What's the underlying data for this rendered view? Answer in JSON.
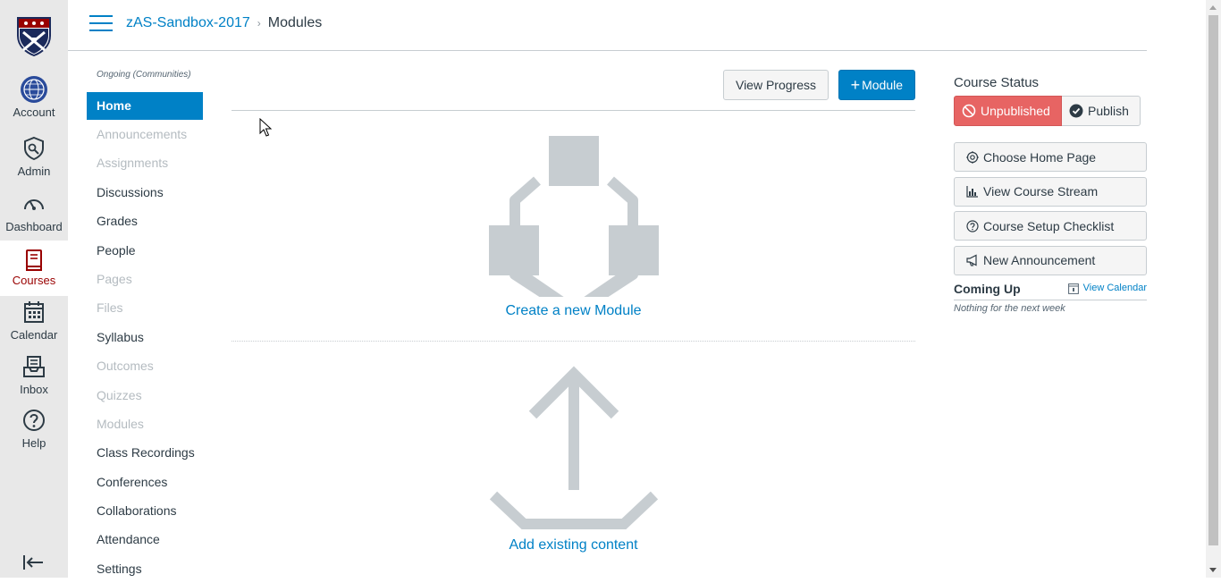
{
  "global_nav": {
    "items": [
      {
        "label": "Account",
        "icon": "account-globe-icon"
      },
      {
        "label": "Admin",
        "icon": "admin-shield-icon"
      },
      {
        "label": "Dashboard",
        "icon": "dashboard-gauge-icon"
      },
      {
        "label": "Courses",
        "icon": "courses-book-icon",
        "active": true
      },
      {
        "label": "Calendar",
        "icon": "calendar-icon"
      },
      {
        "label": "Inbox",
        "icon": "inbox-icon"
      },
      {
        "label": "Help",
        "icon": "help-icon"
      }
    ],
    "active_color": "#990000"
  },
  "header": {
    "course_name": "zAS-Sandbox-2017",
    "current_page": "Modules",
    "separator": "›"
  },
  "course_nav": {
    "term": "Ongoing (Communities)",
    "items": [
      {
        "label": "Home",
        "state": "active"
      },
      {
        "label": "Announcements",
        "state": "disabled"
      },
      {
        "label": "Assignments",
        "state": "disabled"
      },
      {
        "label": "Discussions",
        "state": "enabled"
      },
      {
        "label": "Grades",
        "state": "enabled"
      },
      {
        "label": "People",
        "state": "enabled"
      },
      {
        "label": "Pages",
        "state": "disabled"
      },
      {
        "label": "Files",
        "state": "disabled"
      },
      {
        "label": "Syllabus",
        "state": "enabled"
      },
      {
        "label": "Outcomes",
        "state": "disabled"
      },
      {
        "label": "Quizzes",
        "state": "disabled"
      },
      {
        "label": "Modules",
        "state": "disabled"
      },
      {
        "label": "Class Recordings",
        "state": "enabled"
      },
      {
        "label": "Conferences",
        "state": "enabled"
      },
      {
        "label": "Collaborations",
        "state": "enabled"
      },
      {
        "label": "Attendance",
        "state": "enabled"
      },
      {
        "label": "Settings",
        "state": "enabled"
      }
    ]
  },
  "toolbar": {
    "view_progress_label": "View Progress",
    "add_module_label": "Module",
    "add_module_icon": "+"
  },
  "empty_state": {
    "create_label": "Create a new Module",
    "add_existing_label": "Add existing content"
  },
  "sidebar": {
    "course_status_title": "Course Status",
    "unpublished_label": "Unpublished",
    "publish_label": "Publish",
    "buttons": [
      {
        "label": "Choose Home Page",
        "icon": "target-icon"
      },
      {
        "label": "View Course Stream",
        "icon": "stream-chart-icon"
      },
      {
        "label": "Course Setup Checklist",
        "icon": "question-circle-icon"
      },
      {
        "label": "New Announcement",
        "icon": "megaphone-icon"
      }
    ],
    "coming_up_title": "Coming Up",
    "view_calendar_label": "View Calendar",
    "nothing_label": "Nothing for the next week"
  },
  "colors": {
    "brand_blue": "#0081c6",
    "unpublished_red": "#e76463",
    "graphic_gray": "#c7cdd1"
  }
}
